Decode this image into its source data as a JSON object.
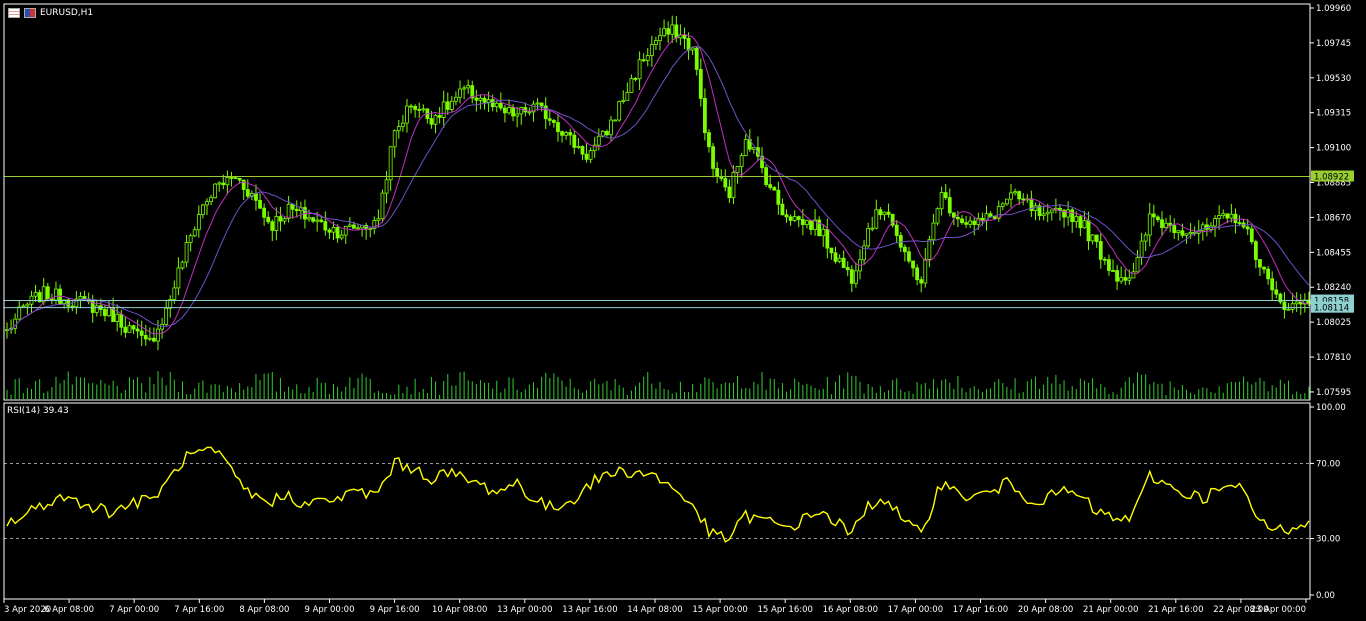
{
  "window": {
    "symbol_label": "EURUSD,H1",
    "icon_names": [
      "chart-window-icon",
      "flag-icon"
    ]
  },
  "colors": {
    "background": "#000000",
    "frame": "#ffffff",
    "candle": "#7cfc00",
    "ma_fast": "#c030c0",
    "ma_slow": "#7050c8",
    "hline": "#9acd32",
    "hline2": "#8fd0d0",
    "rsi": "#ffff00",
    "volume": "#32cd32",
    "grid": "#cccccc"
  },
  "chart_data": [
    {
      "type": "candlestick",
      "symbol": "EURUSD",
      "timeframe": "H1",
      "ylim": [
        1.0757,
        1.0996
      ],
      "y_ticks": [
        "1.09960",
        "1.09745",
        "1.09530",
        "1.09315",
        "1.09100",
        "1.08885",
        "1.08670",
        "1.08455",
        "1.08240",
        "1.08025",
        "1.07810",
        "1.07595"
      ],
      "x_ticks": [
        "3 Apr 2020",
        "6 Apr 08:00",
        "7 Apr 00:00",
        "7 Apr 16:00",
        "8 Apr 08:00",
        "9 Apr 00:00",
        "9 Apr 16:00",
        "10 Apr 08:00",
        "13 Apr 00:00",
        "13 Apr 16:00",
        "14 Apr 08:00",
        "15 Apr 00:00",
        "15 Apr 16:00",
        "16 Apr 08:00",
        "17 Apr 00:00",
        "17 Apr 16:00",
        "20 Apr 08:00",
        "21 Apr 00:00",
        "21 Apr 16:00",
        "22 Apr 08:00",
        "23 Apr 00:00"
      ],
      "close_path": [
        1.0797,
        1.0812,
        1.082,
        1.0818,
        1.0815,
        1.0812,
        1.0807,
        1.0798,
        1.0788,
        1.0808,
        1.0842,
        1.0872,
        1.0887,
        1.0892,
        1.088,
        1.0862,
        1.0872,
        1.0868,
        1.0862,
        1.0858,
        1.0862,
        1.0862,
        1.0918,
        1.0938,
        1.0928,
        1.0935,
        1.0945,
        1.094,
        1.0932,
        1.093,
        1.0935,
        1.0928,
        1.0915,
        1.0905,
        1.0918,
        1.094,
        1.0962,
        1.0978,
        1.0982,
        1.097,
        1.09,
        1.088,
        1.0918,
        1.0895,
        1.0872,
        1.0865,
        1.0862,
        1.0845,
        1.083,
        1.0862,
        1.0875,
        1.0842,
        1.0828,
        1.0882,
        1.0868,
        1.0862,
        1.0868,
        1.088,
        1.0875,
        1.0865,
        1.0872,
        1.0865,
        1.0848,
        1.0832,
        1.083,
        1.0868,
        1.0862,
        1.086,
        1.0858,
        1.0865,
        1.0868,
        1.0845,
        1.0818,
        1.0812,
        1.0816
      ],
      "horizontal_levels": [
        {
          "value": 1.08922,
          "label": "1.08922"
        },
        {
          "value": 1.08158,
          "label": "1.08158"
        },
        {
          "value": 1.08114,
          "label": "1.08114"
        }
      ]
    },
    {
      "type": "line",
      "title": "RSI(14) 39.43",
      "ylim": [
        0,
        100
      ],
      "y_ticks": [
        "100.00",
        "70.00",
        "30.00",
        "0.00"
      ],
      "levels": [
        70,
        30
      ],
      "path": [
        38,
        42,
        48,
        52,
        50,
        47,
        44,
        49,
        50,
        58,
        72,
        76,
        75,
        62,
        52,
        50,
        53,
        48,
        50,
        52,
        55,
        53,
        70,
        68,
        62,
        65,
        62,
        58,
        55,
        60,
        50,
        46,
        50,
        58,
        64,
        66,
        65,
        63,
        55,
        48,
        32,
        30,
        42,
        40,
        36,
        38,
        45,
        40,
        32,
        48,
        52,
        38,
        32,
        60,
        54,
        52,
        55,
        60,
        52,
        50,
        56,
        52,
        44,
        40,
        42,
        64,
        58,
        54,
        52,
        56,
        58,
        42,
        34,
        36,
        40
      ],
      "last_value": 39.43
    }
  ]
}
